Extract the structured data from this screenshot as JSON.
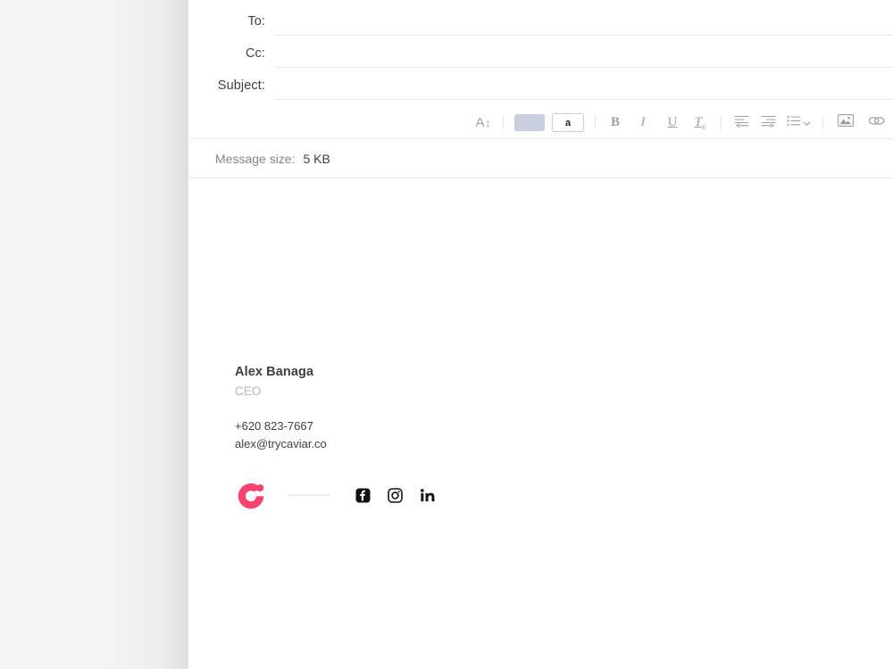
{
  "window": {
    "app": "mail-compose"
  },
  "fields": [
    {
      "key": "to",
      "label": "To:",
      "value": "",
      "placeholder": ""
    },
    {
      "key": "cc",
      "label": "Cc:",
      "value": "",
      "placeholder": ""
    },
    {
      "key": "subject",
      "label": "Subject:",
      "value": "",
      "placeholder": ""
    }
  ],
  "toolbar": {
    "font_size_label": "A",
    "font_size_arrow": "↕",
    "text_color_swatch": "#c7cede",
    "background_color_label": "a",
    "bold_label": "B",
    "italic_label": "I",
    "underline_label": "U",
    "clear_format_label": "T",
    "clear_format_sub": "x",
    "outdent_label": "outdent-icon",
    "indent_label": "indent-icon",
    "list_label": "bulleted-list-icon",
    "image_label": "insert-image-icon",
    "link_label": "insert-link-icon"
  },
  "status": {
    "message_size_label": "Message size:",
    "message_size_value": "5 KB"
  },
  "signature": {
    "name": "Alex Banaga",
    "title": "CEO",
    "phone": "+620 823-7667",
    "email": "alex@trycaviar.co",
    "logo_color": "#f8436f",
    "socials": [
      {
        "name": "facebook",
        "label": "Facebook"
      },
      {
        "name": "instagram",
        "label": "Instagram"
      },
      {
        "name": "linkedin",
        "label": "LinkedIn"
      }
    ]
  }
}
